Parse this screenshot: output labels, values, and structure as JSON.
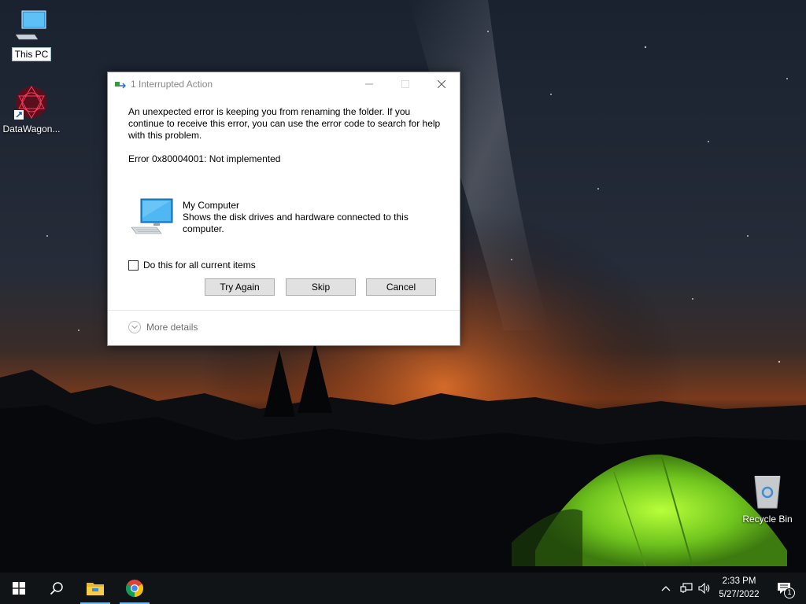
{
  "desktop": {
    "icons": [
      {
        "label": "This PC"
      },
      {
        "label": "DataWagon..."
      },
      {
        "label": "Recycle Bin"
      }
    ]
  },
  "dialog": {
    "title": "1 Interrupted Action",
    "message": "An unexpected error is keeping you from renaming the folder. If you continue to receive this error, you can use the error code to search for help with this problem.",
    "error": "Error 0x80004001: Not implemented",
    "item_name": "My Computer",
    "item_description": "Shows the disk drives and hardware connected to this computer.",
    "checkbox_label": "Do this for all current items",
    "checkbox_checked": false,
    "buttons": {
      "try_again": "Try Again",
      "skip": "Skip",
      "cancel": "Cancel"
    },
    "more_details": "More details"
  },
  "taskbar": {
    "pinned": [
      "start-icon",
      "search-icon",
      "file-explorer-icon",
      "chrome-icon"
    ],
    "tray": {
      "time": "2:33 PM",
      "date": "5/27/2022",
      "notification_count": "1"
    }
  },
  "colors": {
    "taskbar": "#101417",
    "tent_green": "#7ed321",
    "sunset": "#d4622a",
    "button_face": "#e1e1e1"
  }
}
